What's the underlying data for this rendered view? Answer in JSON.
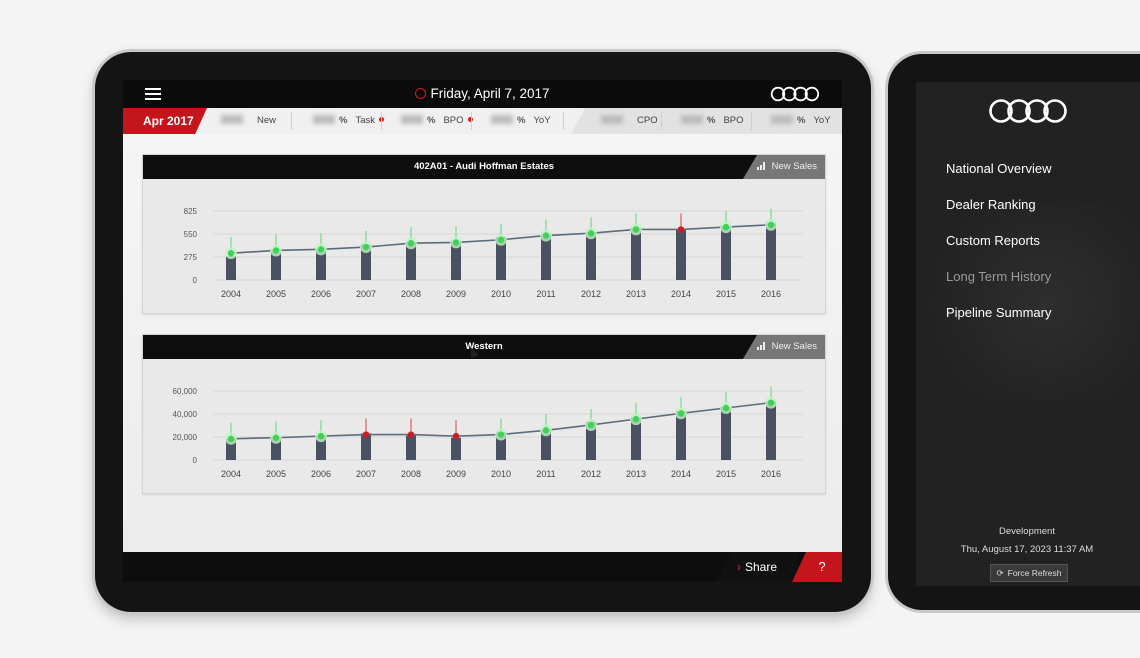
{
  "header": {
    "date": "Friday, April 7, 2017"
  },
  "statbar": {
    "period": "Apr 2017",
    "stats": [
      {
        "label": "New",
        "pct": false,
        "dot": false
      },
      {
        "label": "Task",
        "pct": true,
        "dot": true
      },
      {
        "label": "BPO",
        "pct": true,
        "dot": true
      },
      {
        "label": "YoY",
        "pct": true,
        "dot": false
      },
      {
        "label": "CPO",
        "pct": false,
        "dot": false
      },
      {
        "label": "BPO",
        "pct": true,
        "dot": false
      },
      {
        "label": "YoY",
        "pct": true,
        "dot": false
      }
    ],
    "pct_symbol": "%"
  },
  "panels": [
    {
      "title": "402A01 - Audi Hoffman Estates",
      "tab": "New Sales"
    },
    {
      "title": "Western",
      "tab": "New Sales"
    }
  ],
  "chart_data": [
    {
      "type": "bar",
      "title": "402A01 - Audi Hoffman Estates",
      "categories": [
        "2004",
        "2005",
        "2006",
        "2007",
        "2008",
        "2009",
        "2010",
        "2011",
        "2012",
        "2013",
        "2014",
        "2015",
        "2016"
      ],
      "y_ticks": [
        "0",
        "275",
        "550",
        "825"
      ],
      "ylim": [
        0,
        900
      ],
      "values": [
        310,
        365,
        385,
        460,
        495,
        505,
        560,
        590,
        625,
        680,
        660,
        690,
        740
      ],
      "line_values": [
        350,
        385,
        400,
        430,
        480,
        490,
        525,
        580,
        610,
        660,
        660,
        690,
        720
      ],
      "marker_status": [
        "green",
        "green",
        "green",
        "green",
        "green",
        "green",
        "green",
        "green",
        "green",
        "green",
        "red",
        "green",
        "green"
      ],
      "grid": true
    },
    {
      "type": "bar",
      "title": "Western",
      "categories": [
        "2004",
        "2005",
        "2006",
        "2007",
        "2008",
        "2009",
        "2010",
        "2011",
        "2012",
        "2013",
        "2014",
        "2015",
        "2016"
      ],
      "y_ticks": [
        "0",
        "20,000",
        "40,000",
        "60,000"
      ],
      "ylim": [
        0,
        65000
      ],
      "values": [
        20000,
        21000,
        23000,
        25000,
        23000,
        21000,
        26000,
        28000,
        36000,
        40000,
        46000,
        50000,
        55000
      ],
      "line_values": [
        20000,
        21000,
        22500,
        24000,
        24000,
        22500,
        24000,
        28000,
        33000,
        38500,
        44000,
        49000,
        54000
      ],
      "marker_status": [
        "green",
        "green",
        "green",
        "red",
        "red",
        "red",
        "green",
        "green",
        "green",
        "green",
        "green",
        "green",
        "green"
      ],
      "grid": true
    }
  ],
  "bottombar": {
    "share": "Share",
    "help": "?"
  },
  "sidebar": {
    "items": [
      {
        "label": "National Overview",
        "dim": false
      },
      {
        "label": "Dealer Ranking",
        "dim": false
      },
      {
        "label": "Custom Reports",
        "dim": false
      },
      {
        "label": "Long Term History",
        "dim": true
      },
      {
        "label": "Pipeline Summary",
        "dim": false
      }
    ],
    "environment": "Development",
    "timestamp": "Thu, August 17, 2023 11:37 AM",
    "refresh_label": "Force Refresh"
  },
  "colors": {
    "accent": "#c4141c",
    "bar": "#4a5160",
    "good": "#3fd15a",
    "bad": "#d01b22",
    "line": "#5d6b7a"
  }
}
